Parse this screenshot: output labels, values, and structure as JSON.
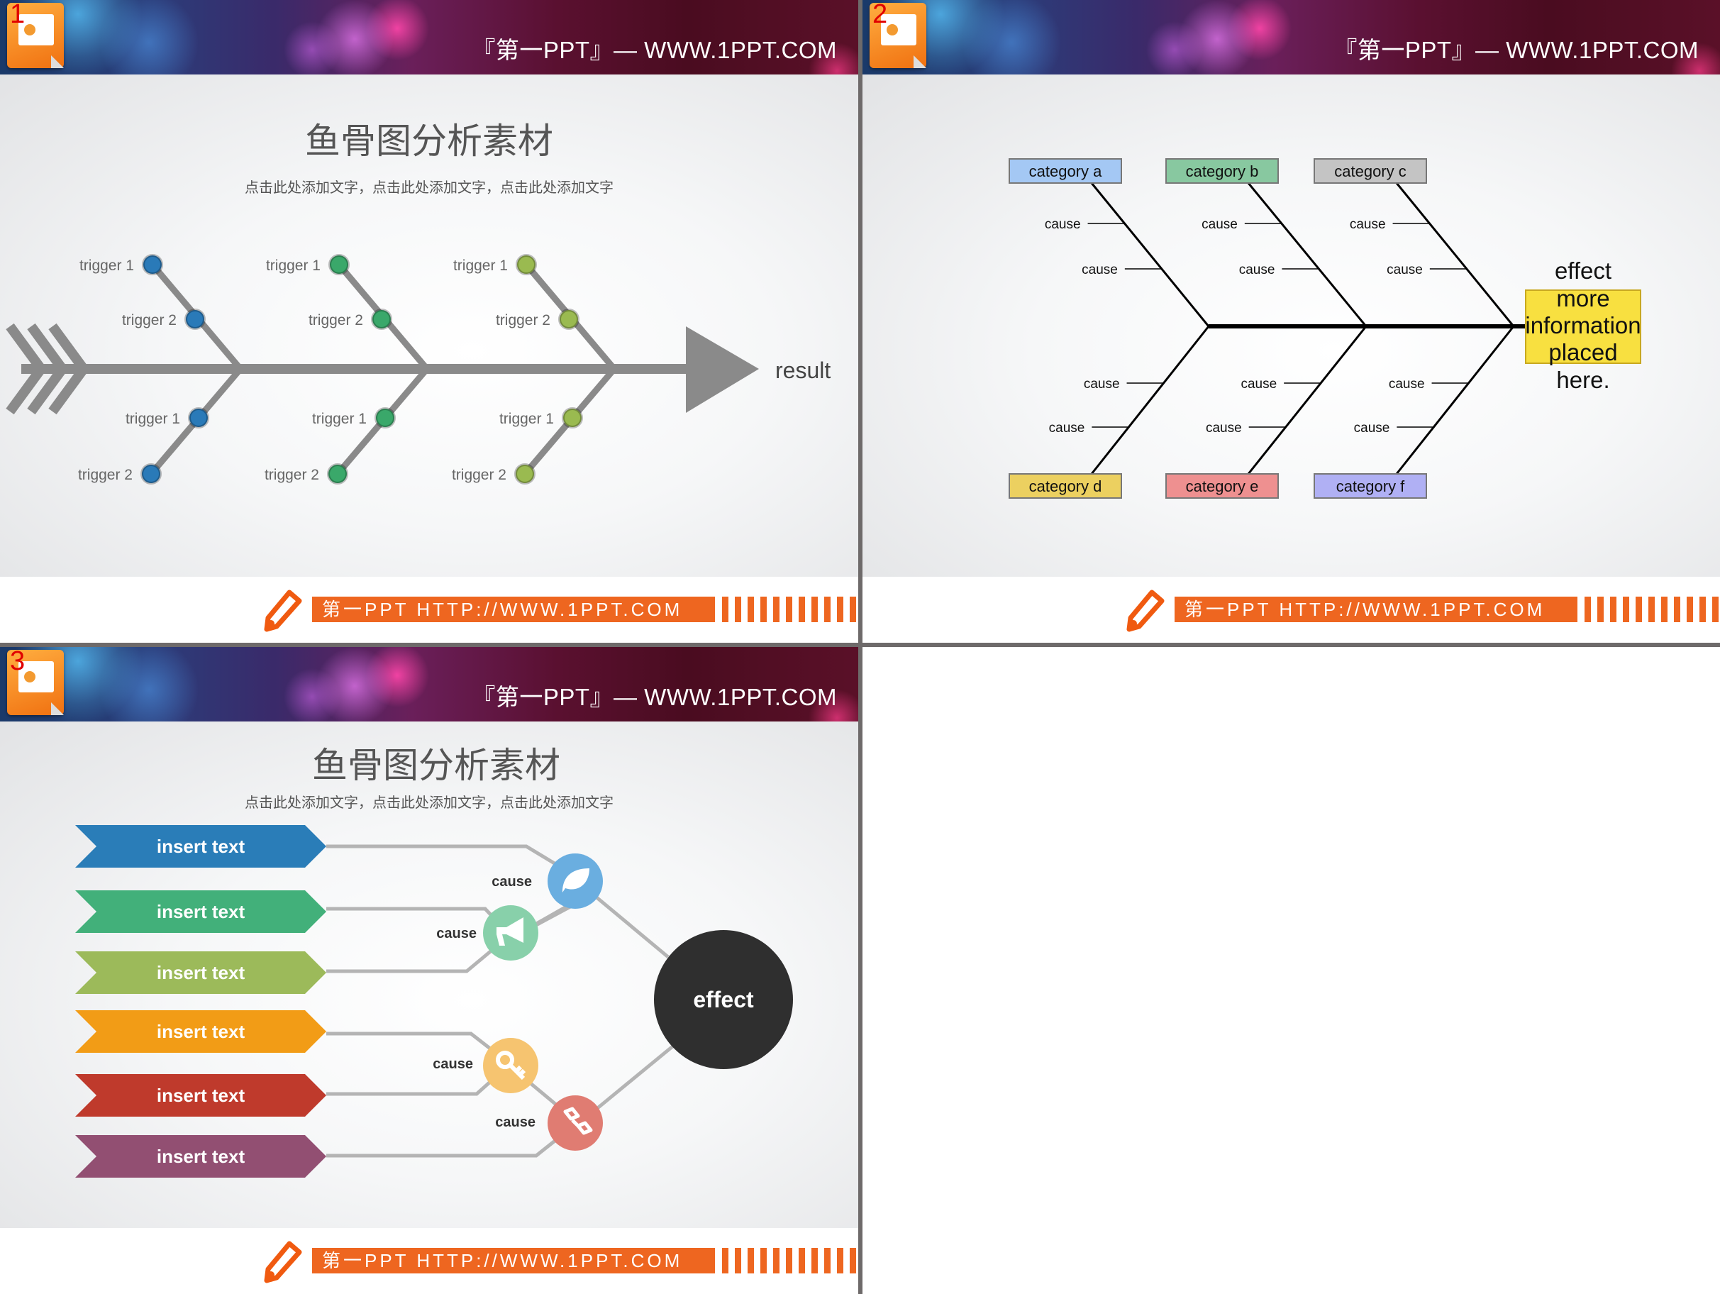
{
  "header": {
    "brand_text": "『第一PPT』— WWW.1PPT.COM",
    "logo_icon": "powerpoint-icon"
  },
  "footer": {
    "bar_text": "第一PPT HTTP://WWW.1PPT.COM",
    "icon": "pencil-icon",
    "accent_color": "#ee6620"
  },
  "slides": [
    {
      "number": "1",
      "title": "鱼骨图分析素材",
      "subtitle": "点击此处添加文字，点击此处添加文字，点击此处添加文字",
      "result_label": "result",
      "branches": [
        {
          "color": "#2a7ab8",
          "top": [
            "trigger 1",
            "trigger 2"
          ],
          "bottom": [
            "trigger 1",
            "trigger 2"
          ]
        },
        {
          "color": "#3aa86a",
          "top": [
            "trigger 1",
            "trigger 2"
          ],
          "bottom": [
            "trigger 1",
            "trigger 2"
          ]
        },
        {
          "color": "#9aba50",
          "top": [
            "trigger 1",
            "trigger 2"
          ],
          "bottom": [
            "trigger 1",
            "trigger 2"
          ]
        }
      ]
    },
    {
      "number": "2",
      "effect_lines": [
        "effect",
        "more",
        "information",
        "placed",
        "here."
      ],
      "top_categories": [
        {
          "label": "category a",
          "color": "#a4c8f4",
          "causes": [
            "cause",
            "cause"
          ]
        },
        {
          "label": "category b",
          "color": "#88c8a0",
          "causes": [
            "cause",
            "cause"
          ]
        },
        {
          "label": "category c",
          "color": "#c4c4c4",
          "causes": [
            "cause",
            "cause"
          ]
        }
      ],
      "bottom_categories": [
        {
          "label": "category d",
          "color": "#ecd060",
          "causes": [
            "cause",
            "cause"
          ]
        },
        {
          "label": "category e",
          "color": "#ee9090",
          "causes": [
            "cause",
            "cause"
          ]
        },
        {
          "label": "category f",
          "color": "#b0b0f4",
          "causes": [
            "cause",
            "cause"
          ]
        }
      ]
    },
    {
      "number": "3",
      "title": "鱼骨图分析素材",
      "subtitle": "点击此处添加文字，点击此处添加文字，点击此处添加文字",
      "effect_label": "effect",
      "arrows": [
        {
          "label": "insert text",
          "color": "#2a7db8"
        },
        {
          "label": "insert text",
          "color": "#42b07a"
        },
        {
          "label": "insert text",
          "color": "#9cba5a"
        },
        {
          "label": "insert text",
          "color": "#f29c16"
        },
        {
          "label": "insert text",
          "color": "#bf3a2c"
        },
        {
          "label": "insert text",
          "color": "#924f72"
        }
      ],
      "nodes": [
        {
          "label": "cause",
          "icon": "leaf-icon",
          "color": "#6aaee0"
        },
        {
          "label": "cause",
          "icon": "megaphone-icon",
          "color": "#88d0aa"
        },
        {
          "label": "cause",
          "icon": "key-icon",
          "color": "#f6c470"
        },
        {
          "label": "cause",
          "icon": "link-icon",
          "color": "#e07c72"
        }
      ]
    }
  ]
}
